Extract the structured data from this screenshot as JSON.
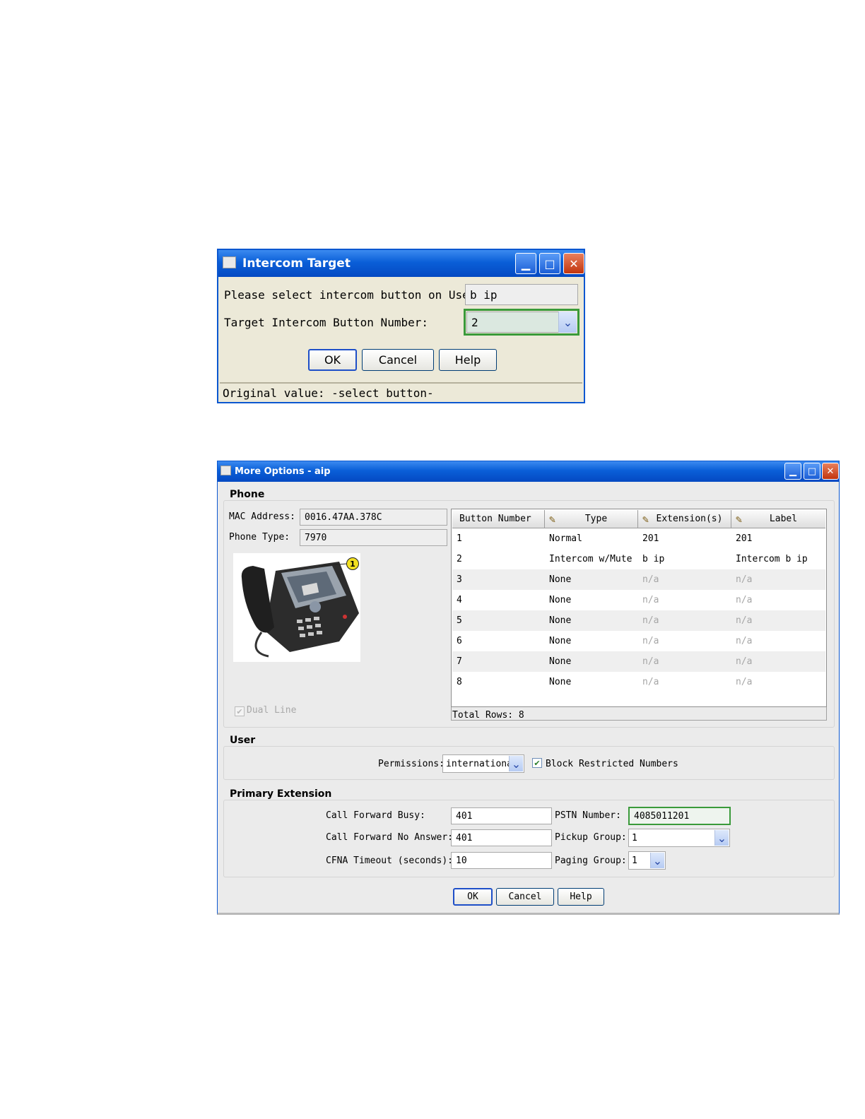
{
  "intercom_dialog": {
    "title": "Intercom Target",
    "user_label": "Please select intercom button on User:",
    "user_value": "b ip",
    "target_label": "Target Intercom Button Number:",
    "target_value": "2",
    "ok_label": "OK",
    "cancel_label": "Cancel",
    "help_label": "Help",
    "status_text": "Original value: -select button-"
  },
  "more_options": {
    "title": "More Options - aip",
    "phone": {
      "group_title": "Phone",
      "mac_label": "MAC Address:",
      "mac_value": "0016.47AA.378C",
      "type_label": "Phone Type:",
      "type_value": "7970",
      "callout_number": "1",
      "dual_line_label": "Dual Line",
      "dual_line_checked": true
    },
    "table": {
      "columns": [
        "Button Number",
        "Type",
        "Extension(s)",
        "Label"
      ],
      "rows": [
        {
          "number": "1",
          "type": "Normal",
          "extension": "201",
          "label": "201"
        },
        {
          "number": "2",
          "type": "Intercom w/Mute",
          "extension": "b ip",
          "label": "Intercom b ip"
        },
        {
          "number": "3",
          "type": "None",
          "extension": "n/a",
          "label": "n/a"
        },
        {
          "number": "4",
          "type": "None",
          "extension": "n/a",
          "label": "n/a"
        },
        {
          "number": "5",
          "type": "None",
          "extension": "n/a",
          "label": "n/a"
        },
        {
          "number": "6",
          "type": "None",
          "extension": "n/a",
          "label": "n/a"
        },
        {
          "number": "7",
          "type": "None",
          "extension": "n/a",
          "label": "n/a"
        },
        {
          "number": "8",
          "type": "None",
          "extension": "n/a",
          "label": "n/a"
        }
      ],
      "total_rows": "Total Rows: 8"
    },
    "user": {
      "group_title": "User",
      "permissions_label": "Permissions:",
      "permissions_value": "international",
      "block_label": "Block Restricted Numbers",
      "block_checked": true
    },
    "extension": {
      "group_title": "Primary Extension",
      "cfb_label": "Call Forward Busy:",
      "cfb_value": "401",
      "cfna_label": "Call Forward No Answer:",
      "cfna_value": "401",
      "timeout_label": "CFNA Timeout (seconds):",
      "timeout_value": "10",
      "pstn_label": "PSTN Number:",
      "pstn_value": "4085011201",
      "pickup_label": "Pickup Group:",
      "pickup_value": "1",
      "paging_label": "Paging Group:",
      "paging_value": "1"
    },
    "ok_label": "OK",
    "cancel_label": "Cancel",
    "help_label": "Help"
  },
  "icons": {
    "minimize": "minimize-icon",
    "maximize": "maximize-icon",
    "close": "close-icon",
    "dropdown": "chevron-down-icon",
    "edit": "pencil-icon",
    "check": "checkmark-icon"
  },
  "colors": {
    "title_bar": "#0a5fd8",
    "highlight_border": "#3a9a3a",
    "close_button": "#c2350d"
  }
}
